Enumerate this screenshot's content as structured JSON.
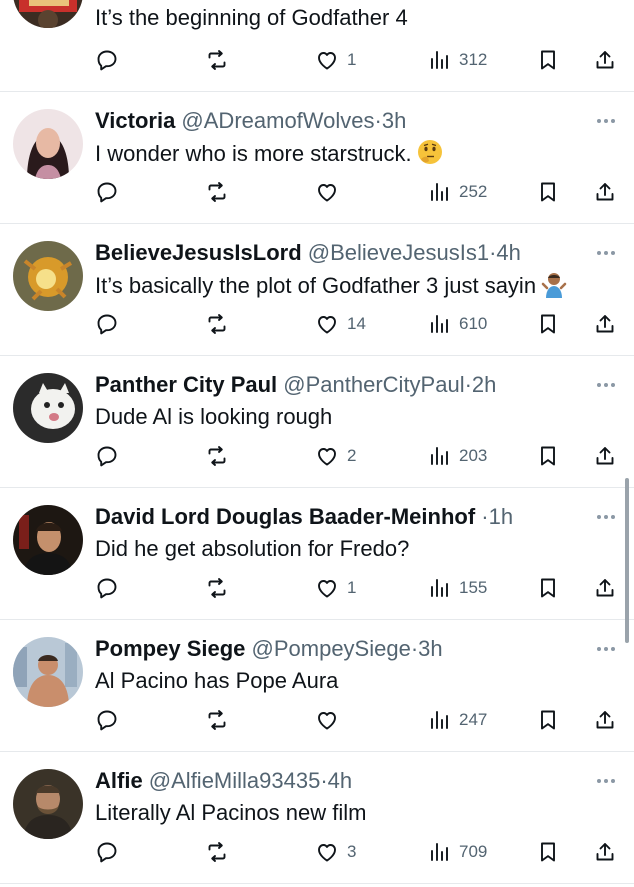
{
  "posts": [
    {
      "avatar_icon": "avatar-user-1",
      "name": "",
      "handle": "",
      "time": "",
      "text": "It’s the beginning of Godfather 4",
      "replies": "",
      "reposts": "",
      "likes": "1",
      "views": "312"
    },
    {
      "avatar_icon": "avatar-victoria",
      "name": "Victoria",
      "handle": "@ADreamofWolves",
      "sep": "·",
      "time": "3h",
      "text": "I wonder who is more starstruck.",
      "emoji": "thinking-face-emoji",
      "replies": "",
      "reposts": "",
      "likes": "",
      "views": "252"
    },
    {
      "avatar_icon": "avatar-believejesusislord",
      "name": "BelieveJesusIsLord",
      "handle": "@BelieveJesusIs1",
      "sep": "·",
      "time": "4h",
      "text": "It’s basically the plot of Godfather 3 just sayin",
      "emoji": "shrugging-person-emoji",
      "replies": "",
      "reposts": "",
      "likes": "14",
      "views": "610"
    },
    {
      "avatar_icon": "avatar-panther-city-paul",
      "name": "Panther City Paul",
      "handle": "@PantherCityPaul",
      "sep": "·",
      "time": "2h",
      "text": "Dude Al is looking rough",
      "replies": "",
      "reposts": "",
      "likes": "2",
      "views": "203"
    },
    {
      "avatar_icon": "avatar-david-lord",
      "name": "David Lord Douglas Baader-Meinhof",
      "handle": "",
      "sep": "·",
      "time": "1h",
      "text": "Did he get absolution for Fredo?",
      "replies": "",
      "reposts": "",
      "likes": "1",
      "views": "155"
    },
    {
      "avatar_icon": "avatar-pompey-siege",
      "name": "Pompey Siege",
      "handle": "@PompeySiege",
      "sep": "·",
      "time": "3h",
      "text": "Al Pacino has Pope Aura",
      "replies": "",
      "reposts": "",
      "likes": "",
      "views": "247"
    },
    {
      "avatar_icon": "avatar-alfie",
      "name": "Alfie",
      "handle": "@AlfieMilla93435",
      "sep": "·",
      "time": "4h",
      "text": "Literally Al Pacinos new film",
      "replies": "",
      "reposts": "",
      "likes": "3",
      "views": "709"
    }
  ],
  "icons": {
    "reply": "reply-icon",
    "repost": "repost-icon",
    "like": "heart-icon",
    "views": "views-icon",
    "bookmark": "bookmark-icon",
    "share": "share-icon",
    "more": "more-icon"
  },
  "colors": {
    "text": "#0f1419",
    "secondary": "#536471",
    "divider": "#e6e9ec"
  }
}
